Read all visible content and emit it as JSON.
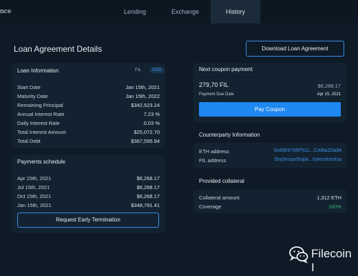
{
  "brand": "nce",
  "nav": {
    "tabs": [
      {
        "label": "Lending"
      },
      {
        "label": "Exchange"
      },
      {
        "label": "History"
      }
    ]
  },
  "page": {
    "title": "Loan Agreement Details",
    "download_label": "Download Loan Agreement"
  },
  "loan_info": {
    "title": "Loan Information",
    "currency_toggle": [
      "FIL",
      "USD"
    ],
    "selected_currency": "USD",
    "rows": [
      {
        "label": "Start Date",
        "value": "Jan 15th, 2021"
      },
      {
        "label": "Maturity Date",
        "value": "Jan 15th, 2022"
      },
      {
        "label": "Remaining Principal",
        "value": "$342,523.24"
      },
      {
        "label": "Annual Interest Rate",
        "value": "7.23 %"
      },
      {
        "label": "Daily Interest Rate",
        "value": "0.03 %"
      },
      {
        "label": "Total Interest Amount",
        "value": "$25,072.70"
      },
      {
        "label": "Total Debt",
        "value": "$367,595.94"
      }
    ]
  },
  "payments": {
    "title": "Payments schedule",
    "rows": [
      {
        "label": "Apr 15th, 2021",
        "value": "$6,268.17"
      },
      {
        "label": "Jul 15th, 2021",
        "value": "$6,268.17"
      },
      {
        "label": "Oct 15th, 2021",
        "value": "$6,268.17"
      },
      {
        "label": "Jan 15th, 2021",
        "value": "$348,791.41"
      }
    ],
    "button_label": "Request Early Termination"
  },
  "coupon": {
    "title": "Next coupon payment",
    "amount_fil": "279,70 FIL",
    "amount_usd": "$6,268.17",
    "due_label": "Payment Due Date",
    "due_value": "Apr 15, 2021",
    "button_label": "Pay Coupon"
  },
  "counterparty": {
    "title": "Counterparty Information",
    "rows": [
      {
        "label": "ETH address",
        "value": "0xd9E8795Ff111...CAf8a2Da94"
      },
      {
        "label": "FIL address",
        "value": "f3ry3mzpv5isjlai...0ykmzksmlsa"
      }
    ]
  },
  "collateral": {
    "title": "Provided collateral",
    "rows": [
      {
        "label": "Collateral amount",
        "value": "1,312 ETH"
      },
      {
        "label": "Coverage",
        "value": "160%"
      }
    ]
  },
  "watermark": {
    "text": "Filecoin I"
  },
  "colors": {
    "background": "#0e1a26",
    "card": "#132230",
    "accent": "#1e88f0",
    "link": "#3a8ee6",
    "success": "#2eb872"
  }
}
